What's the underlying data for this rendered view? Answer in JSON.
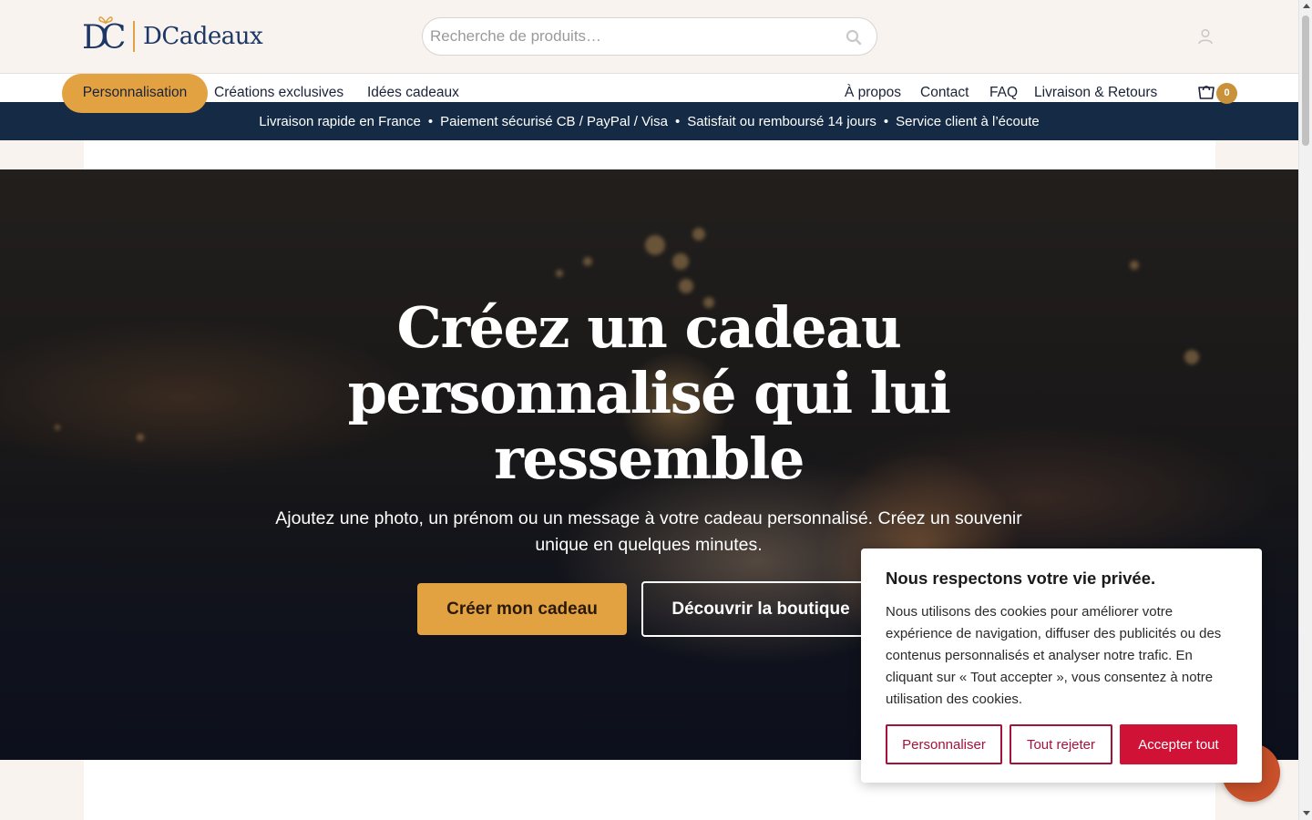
{
  "brand": {
    "name": "DCadeaux",
    "monogram": "DC",
    "accent_color": "#e3a242",
    "navy_color": "#1d3766"
  },
  "search": {
    "placeholder": "Recherche de produits…",
    "value": ""
  },
  "nav": {
    "left": [
      {
        "label": "Personnalisation",
        "active": true
      },
      {
        "label": "Créations exclusives"
      },
      {
        "label": "Idées cadeaux"
      }
    ],
    "right": [
      {
        "label": "À propos"
      },
      {
        "label": "Contact"
      },
      {
        "label": "FAQ"
      },
      {
        "label": "Livraison & Retours"
      }
    ],
    "cart_count": "0"
  },
  "promo": {
    "items": [
      "Livraison rapide en France",
      "Paiement sécurisé CB / PayPal / Visa",
      "Satisfait ou remboursé 14 jours",
      "Service client à l’écoute"
    ],
    "separator": "•",
    "background": "#142a45"
  },
  "hero": {
    "title": "Créez un cadeau personnalisé qui lui ressemble",
    "subtitle": "Ajoutez une photo, un prénom ou un message à votre cadeau personnalisé. Créez un souvenir unique en quelques minutes.",
    "primary_cta": "Créer mon cadeau",
    "secondary_cta": "Découvrir la boutique"
  },
  "cookie": {
    "title": "Nous respectons votre vie privée.",
    "text": "Nous utilisons des cookies pour améliorer votre expérience de navigation, diffuser des publicités ou des contenus personnalisés et analyser notre trafic. En cliquant sur « Tout accepter », vous consentez à notre utilisation des cookies.",
    "customize": "Personnaliser",
    "reject": "Tout rejeter",
    "accept": "Accepter tout",
    "accent_color": "#cf1236"
  },
  "icons": {
    "search": "search-icon",
    "user": "user-icon",
    "cart": "cart-icon",
    "chat": "chat-icon"
  }
}
